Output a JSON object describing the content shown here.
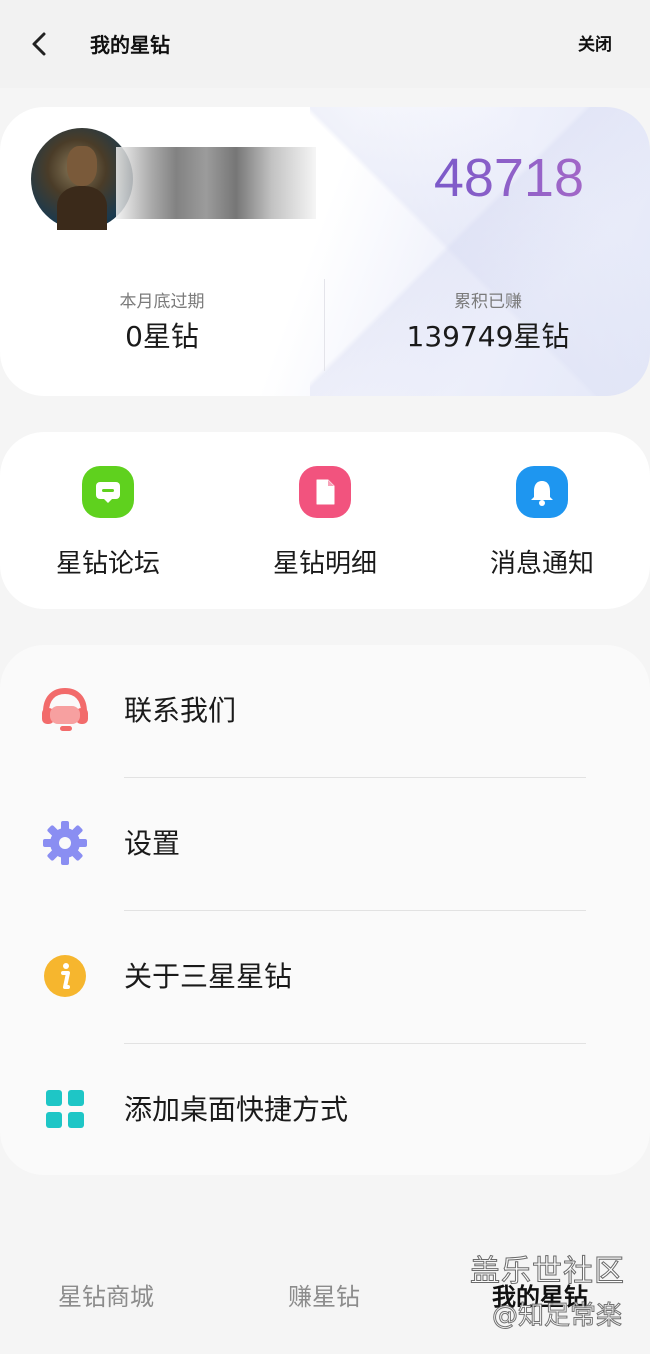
{
  "header": {
    "title": "我的星钻",
    "close_label": "关闭"
  },
  "profile": {
    "balance": "48718",
    "expiring_label": "本月底过期",
    "expiring_value": "0星钻",
    "earned_label": "累积已赚",
    "earned_value": "139749星钻"
  },
  "quick_actions": [
    {
      "label": "星钻论坛",
      "icon": "chat-bubble-icon",
      "color": "#5fd11e"
    },
    {
      "label": "星钻明细",
      "icon": "document-icon",
      "color": "#f2537e"
    },
    {
      "label": "消息通知",
      "icon": "bell-icon",
      "color": "#1e96f0"
    }
  ],
  "menu": [
    {
      "label": "联系我们",
      "icon": "headset-icon",
      "color": "#f26b6b"
    },
    {
      "label": "设置",
      "icon": "gear-icon",
      "color": "#8a8ef2"
    },
    {
      "label": "关于三星星钻",
      "icon": "info-icon",
      "color": "#f6b62e"
    },
    {
      "label": "添加桌面快捷方式",
      "icon": "grid-icon",
      "color": "#1ec6c6"
    }
  ],
  "bottom_nav": [
    {
      "label": "星钻商城"
    },
    {
      "label": "赚星钻"
    },
    {
      "label": "我的星钻"
    }
  ],
  "watermark": {
    "line1": "盖乐世社区",
    "line2": "@知足常楽"
  }
}
